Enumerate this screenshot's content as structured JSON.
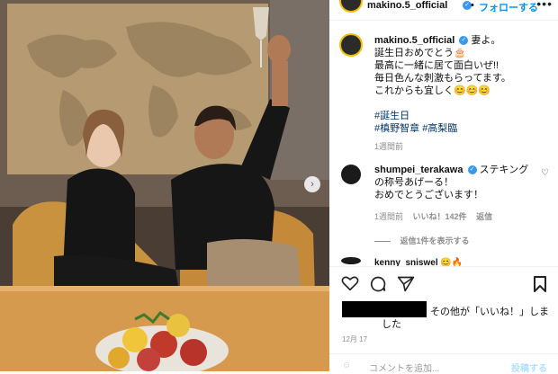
{
  "post": {
    "username": "makino.5_official",
    "follow_label": "フォローする",
    "caption_lines": [
      "妻よ。",
      "誕生日おめでとう🎂",
      "最高に一緒に居て面白いぜ!!",
      "毎日色んな刺激もらってます。",
      "これからも宜しく😊😊😊"
    ],
    "hashtags": [
      "#誕生日",
      "#槙野智章",
      "#高梨臨"
    ],
    "time_ago": "1週間前"
  },
  "comments": [
    {
      "username": "shumpei_terakawa",
      "text_line1": "ステキング",
      "text_line2": "の称号あげーる！",
      "text_line3": "おめでとうございます！",
      "time_ago": "1週間前",
      "likes": "いいね！142件",
      "reply": "返信",
      "view_replies": "返信1件を表示する"
    }
  ],
  "partial_comment": {
    "username": "kenny_sniswel",
    "emoji": "😊🔥"
  },
  "likes_line": {
    "suffix": "その他が「いいね！」しま",
    "suffix2": "した"
  },
  "date": "12月 17",
  "add_comment_placeholder": "コメントを追加...",
  "post_label": "投稿する"
}
